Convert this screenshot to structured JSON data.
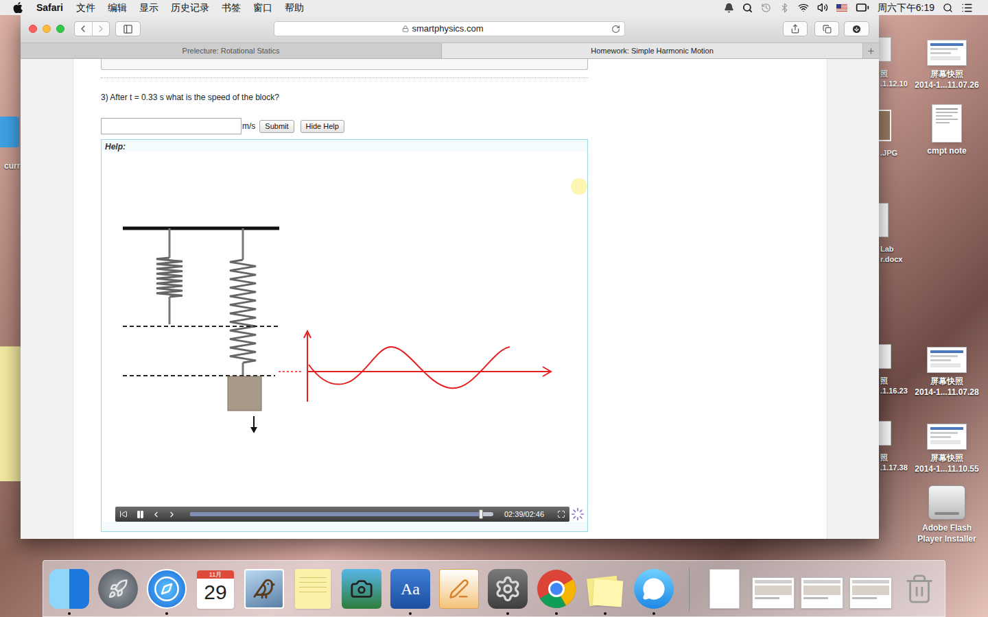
{
  "menubar": {
    "app": "Safari",
    "menus": [
      "文件",
      "编辑",
      "显示",
      "历史记录",
      "书签",
      "窗口",
      "帮助"
    ],
    "clock": "周六下午6:19"
  },
  "browser": {
    "url": "smartphysics.com",
    "tabs": [
      {
        "label": "Prelecture: Rotational Statics",
        "selected": false
      },
      {
        "label": "Homework: Simple Harmonic Motion",
        "selected": true
      }
    ]
  },
  "page": {
    "question": "3) After t = 0.33 s what is the speed of the block?",
    "answer": "",
    "unit": "m/s",
    "buttons": [
      "Submit",
      "Hide Help"
    ],
    "help_title": "Help:",
    "video": {
      "playing": true,
      "level": 0.96,
      "time": "02:39/02:46"
    }
  },
  "desktop_icons": [
    {
      "kind": "screenshot",
      "lines": [
        "屏幕快照",
        "2014-1...11.07.26"
      ]
    },
    {
      "kind": "document",
      "lines": [
        "cmpt note"
      ]
    },
    {
      "kind": "screenshot",
      "lines": [
        "屏幕快照",
        "2014-1...11.07.28"
      ]
    },
    {
      "kind": "screenshot",
      "lines": [
        "屏幕快照",
        "2014-1...11.10.55"
      ]
    },
    {
      "kind": "drive",
      "lines": [
        "Adobe Flash",
        "Player Installer"
      ]
    }
  ],
  "partial_icons": [
    {
      "kind": "screenshot",
      "lines": [
        "照",
        ".1.12.10"
      ]
    },
    {
      "kind": "photo",
      "lines": [
        ".JPG"
      ]
    },
    {
      "kind": "document",
      "lines": [
        "Lab",
        "r.docx"
      ]
    },
    {
      "kind": "screenshot",
      "lines": [
        "照",
        ".1.16.23"
      ]
    },
    {
      "kind": "screenshot",
      "lines": [
        "照",
        ".1.17.38"
      ]
    }
  ],
  "left_edge": {
    "label": "curr"
  },
  "dock": [
    {
      "kind": "finder",
      "running": true
    },
    {
      "kind": "launchpad",
      "running": false
    },
    {
      "kind": "safari",
      "running": true
    },
    {
      "kind": "calendar",
      "running": false,
      "month": "11月",
      "day": "29"
    },
    {
      "kind": "preview",
      "running": false
    },
    {
      "kind": "notes",
      "running": false
    },
    {
      "kind": "iphoto",
      "running": false
    },
    {
      "kind": "dictionary",
      "running": true,
      "glyph": "Aa"
    },
    {
      "kind": "pages",
      "running": false
    },
    {
      "kind": "settings",
      "running": true
    },
    {
      "kind": "chrome",
      "running": true
    },
    {
      "kind": "stickies",
      "running": true
    },
    {
      "kind": "messages",
      "running": true
    },
    {
      "kind": "document",
      "running": false
    },
    {
      "kind": "window",
      "running": false
    },
    {
      "kind": "window",
      "running": false
    },
    {
      "kind": "window",
      "running": false
    },
    {
      "kind": "trash",
      "running": false
    }
  ]
}
